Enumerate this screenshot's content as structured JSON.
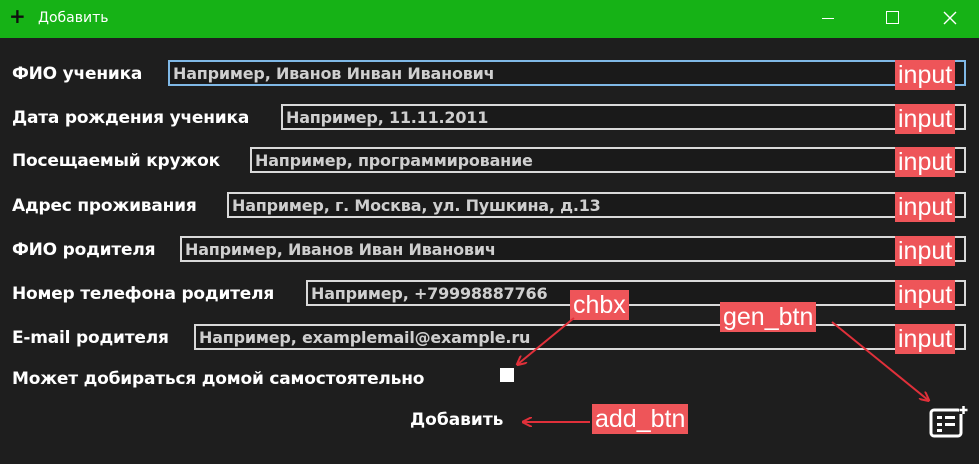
{
  "window": {
    "title": "Добавить",
    "title_icon": "plus-icon",
    "titlebar_color": "#16b216",
    "controls": [
      "minimize-icon",
      "maximize-icon",
      "close-icon"
    ]
  },
  "form": {
    "fields": [
      {
        "label": "ФИО ученика",
        "placeholder": "Например, Иванов Инван Иванович",
        "tag": "input"
      },
      {
        "label": "Дата рождения ученика",
        "placeholder": "Например, 11.11.2011",
        "tag": "input"
      },
      {
        "label": "Посещаемый кружок",
        "placeholder": "Например, программирование",
        "tag": "input"
      },
      {
        "label": "Адрес проживания",
        "placeholder": "Например, г. Москва, ул. Пушкина, д.13",
        "tag": "input"
      },
      {
        "label": "ФИО родителя",
        "placeholder": "Например, Иванов Иван Иванович",
        "tag": "input"
      },
      {
        "label": "Номер телефона родителя",
        "placeholder": "Например, +79998887766",
        "tag": "input"
      },
      {
        "label": "E-mail родителя",
        "placeholder": "Например, examplemail@example.ru",
        "tag": "input"
      }
    ],
    "checkbox_label": "Может добираться домой самостоятельно",
    "add_button": "Добавить",
    "gen_button_icon": "generate-icon"
  },
  "annotations": {
    "chbx": "chbx",
    "gen_btn": "gen_btn",
    "add_btn": "add_btn",
    "tag_color": "#ee5559"
  }
}
